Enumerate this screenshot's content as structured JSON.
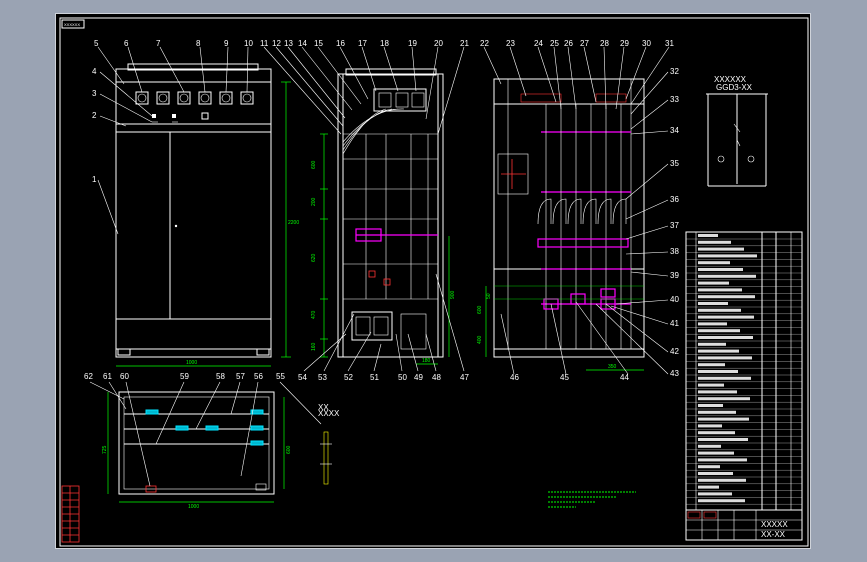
{
  "drawing": {
    "stamp_top_left": "XXXXXX",
    "balloons_top": [
      "5",
      "6",
      "7",
      "8",
      "9",
      "10",
      "11",
      "12",
      "13",
      "14",
      "15",
      "16",
      "17",
      "18",
      "19",
      "20",
      "21",
      "22",
      "23",
      "24",
      "25",
      "26",
      "27",
      "28",
      "29",
      "30",
      "31"
    ],
    "balloons_left": [
      "4",
      "3",
      "2",
      "1"
    ],
    "balloons_right": [
      "32",
      "33",
      "34",
      "35",
      "36",
      "37",
      "38",
      "39",
      "40",
      "41",
      "42",
      "43"
    ],
    "balloons_mid_bottom": [
      "54",
      "53",
      "52",
      "51",
      "50",
      "49",
      "48",
      "47",
      "46",
      "45",
      "44"
    ],
    "balloons_plan": [
      "62",
      "61",
      "60",
      "59",
      "58",
      "57",
      "56",
      "55"
    ],
    "dims": {
      "front_height": "2200",
      "front_width": "1000",
      "side_a": "600",
      "side_b": "200",
      "side_c": "620",
      "side_d": "470",
      "side_e": "160",
      "side_f": "900",
      "side_g": "180",
      "rear_a": "600",
      "rear_b": "50",
      "rear_c": "400",
      "rear_d": "350",
      "plan_width": "1000",
      "plan_depth_a": "725",
      "plan_depth_b": "600"
    },
    "schematic": {
      "title": "XXXXXX",
      "subtitle": "GGD3-XX"
    },
    "title_block": {
      "drawing_name": "XXXXX",
      "drawing_no": "XX-XX"
    }
  },
  "colors": {
    "background": "#000000",
    "frame": "#ffffff",
    "dimension": "#00ff00",
    "busbar": "#ff00ff",
    "insulator": "#00c8e0",
    "annotation": "#ffff00",
    "outer": "#9aa3b3"
  }
}
